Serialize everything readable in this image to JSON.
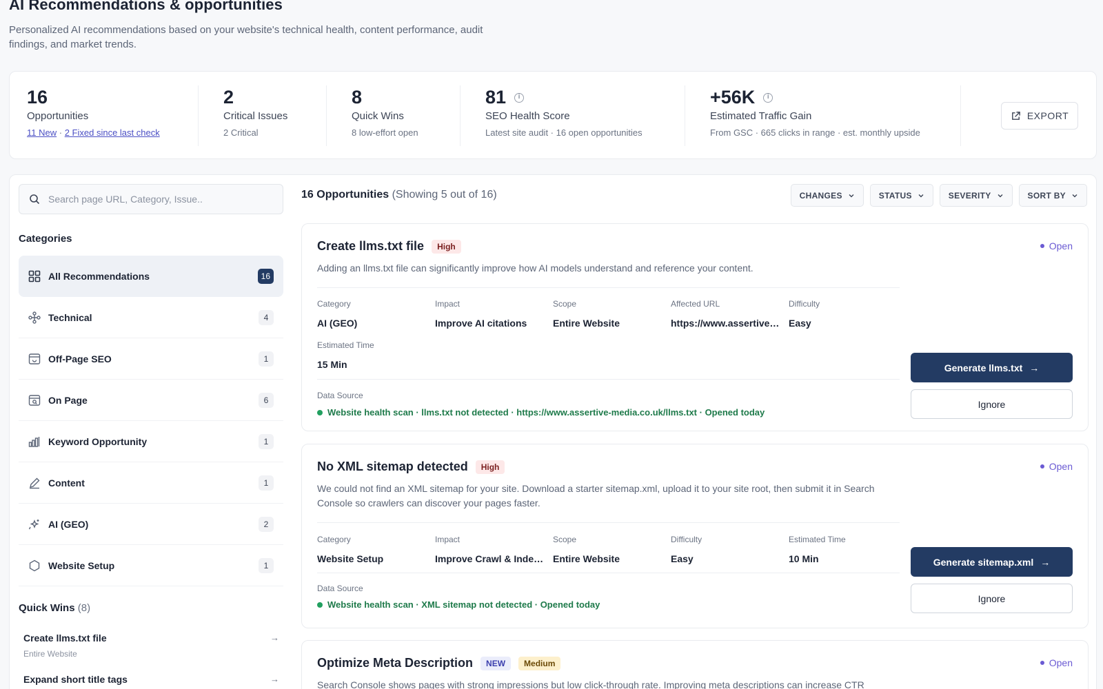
{
  "header": {
    "title": "AI Recommendations & opportunities",
    "subtitle_line1": "Personalized AI recommendations based on your website's technical health, content performance, audit",
    "subtitle_line2": "findings, and market trends."
  },
  "stats": {
    "opportunities": {
      "value": "16",
      "label": "Opportunities",
      "new_link": "11 New",
      "sep": "·",
      "fixed_link": "2 Fixed since last check"
    },
    "critical": {
      "value": "2",
      "label": "Critical Issues",
      "sub": "2 Critical"
    },
    "quick_wins": {
      "value": "8",
      "label": "Quick Wins",
      "sub": "8 low-effort open"
    },
    "seo_health": {
      "value": "81",
      "label": "SEO Health Score",
      "sub": "Latest site audit · 16 open opportunities"
    },
    "traffic": {
      "value": "+56K",
      "label": "Estimated Traffic Gain",
      "sub": "From GSC · 665 clicks in range · est. monthly upside"
    },
    "export_label": "EXPORT"
  },
  "sidebar": {
    "search_placeholder": "Search page URL, Category, Issue..",
    "categories_title": "Categories",
    "categories": [
      {
        "label": "All Recommendations",
        "count": "16",
        "icon": "grid-icon"
      },
      {
        "label": "Technical",
        "count": "4",
        "icon": "nodes-icon"
      },
      {
        "label": "Off-Page SEO",
        "count": "1",
        "icon": "browser-link-icon"
      },
      {
        "label": "On Page",
        "count": "6",
        "icon": "page-search-icon"
      },
      {
        "label": "Keyword Opportunity",
        "count": "1",
        "icon": "bar-chart-icon"
      },
      {
        "label": "Content",
        "count": "1",
        "icon": "pencil-icon"
      },
      {
        "label": "AI (GEO)",
        "count": "2",
        "icon": "sparkle-icon"
      },
      {
        "label": "Website Setup",
        "count": "1",
        "icon": "settings-icon"
      }
    ],
    "quick_wins_title": "Quick Wins",
    "quick_wins_count": "(8)",
    "quick_wins": [
      {
        "name": "Create llms.txt file",
        "sub": "Entire Website"
      },
      {
        "name": "Expand short title tags",
        "sub": ""
      }
    ]
  },
  "list": {
    "heading": "16 Opportunities",
    "showing": "(Showing 5 out of 16)",
    "filters": [
      "CHANGES",
      "STATUS",
      "SEVERITY",
      "SORT BY"
    ]
  },
  "cards": [
    {
      "title": "Create llms.txt file",
      "badges": [
        {
          "text": "High",
          "kind": "high"
        }
      ],
      "status": "Open",
      "description": "Adding an llms.txt file can significantly improve how AI models understand and reference your content.",
      "fields": [
        {
          "label": "Category",
          "value": "AI (GEO)"
        },
        {
          "label": "Impact",
          "value": "Improve AI citations"
        },
        {
          "label": "Scope",
          "value": "Entire Website"
        },
        {
          "label": "Affected URL",
          "value": "https://www.assertive-media.co.uk/"
        },
        {
          "label": "Difficulty",
          "value": "Easy"
        },
        {
          "label": "Estimated Time",
          "value": "15 Min"
        }
      ],
      "data_source_label": "Data Source",
      "data_source": "Website health scan · llms.txt not detected · https://www.assertive-media.co.uk/llms.txt · Opened today",
      "primary_action": "Generate llms.txt",
      "secondary_action": "Ignore"
    },
    {
      "title": "No XML sitemap detected",
      "badges": [
        {
          "text": "High",
          "kind": "high"
        }
      ],
      "status": "Open",
      "description": "We could not find an XML sitemap for your site. Download a starter sitemap.xml, upload it to your site root, then submit it in Search Console so crawlers can discover your pages faster.",
      "fields": [
        {
          "label": "Category",
          "value": "Website Setup"
        },
        {
          "label": "Impact",
          "value": "Improve Crawl & Indexing"
        },
        {
          "label": "Scope",
          "value": "Entire Website"
        },
        {
          "label": "Difficulty",
          "value": "Easy"
        },
        {
          "label": "Estimated Time",
          "value": "10 Min"
        }
      ],
      "data_source_label": "Data Source",
      "data_source": "Website health scan · XML sitemap not detected · Opened today",
      "primary_action": "Generate sitemap.xml",
      "secondary_action": "Ignore"
    },
    {
      "title": "Optimize Meta Description",
      "badges": [
        {
          "text": "NEW",
          "kind": "new"
        },
        {
          "text": "Medium",
          "kind": "medium"
        }
      ],
      "status": "Open",
      "description": "Search Console shows pages with strong impressions but low click-through rate. Improving meta descriptions can increase CTR"
    }
  ]
}
